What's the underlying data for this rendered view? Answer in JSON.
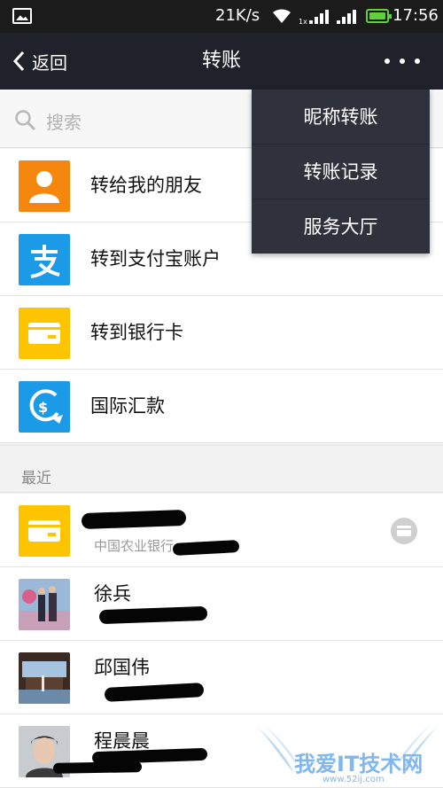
{
  "status_bar": {
    "speed": "21K/s",
    "time": "17:56"
  },
  "nav": {
    "back_label": "返回",
    "title": "转账"
  },
  "search": {
    "placeholder": "搜索"
  },
  "menu": [
    "转给我的朋友",
    "转到支付宝账户",
    "转到银行卡",
    "国际汇款"
  ],
  "section_label": "最近",
  "recent": [
    {
      "name": "",
      "sub": "中国农业银行"
    },
    {
      "name": "徐兵",
      "sub": ""
    },
    {
      "name": "邱国伟",
      "sub": ""
    },
    {
      "name": "程晨晨",
      "sub": ""
    }
  ],
  "popup": [
    "昵称转账",
    "转账记录",
    "服务大厅"
  ],
  "watermark": {
    "title": "我爱IT技术网",
    "url": "www.52ij.com"
  },
  "colors": {
    "nav_bg": "#1f222a",
    "friends_icon": "#f5870f",
    "alipay_icon": "#1a9ae7",
    "card_icon": "#fec400",
    "intl_icon": "#1a9ae7"
  }
}
